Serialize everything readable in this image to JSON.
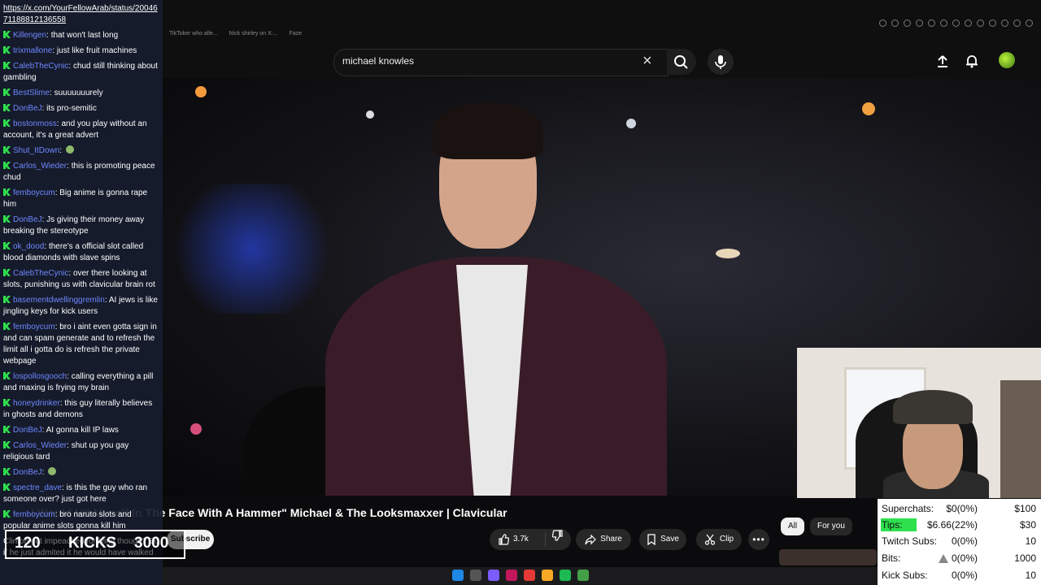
{
  "browser": {
    "tabs": [
      "TikToker who alle...",
      "Nick shirley on X:...",
      "Faze"
    ]
  },
  "youtube": {
    "search_query": "michael knowles",
    "video_title": "I Would Hit Myself In The Face With A Hammer\" Michael & The Looksmaxxer | Clavicular",
    "subscribe_label": "Subscribe",
    "like_count": "3.7k",
    "share_label": "Share",
    "save_label": "Save",
    "clip_label": "Clip",
    "more_label": "•••",
    "chips": [
      "All",
      "For you"
    ]
  },
  "chat": {
    "url": "https://x.com/YourFellowArab/status/2004671188812136558",
    "messages": [
      {
        "user": "Killengen",
        "text": "that won't last long"
      },
      {
        "user": "trixmallone",
        "text": "just like fruit machines"
      },
      {
        "user": "CalebTheCynic",
        "text": "chud still thinking about gambling"
      },
      {
        "user": "BestSlime",
        "text": "suuuuuuurely"
      },
      {
        "user": "DonBeJ",
        "text": "its pro-semitic"
      },
      {
        "user": "bostonmoss",
        "text": "and you play without an account, it's a great advert"
      },
      {
        "user": "Shut_ItDown",
        "text": ""
      },
      {
        "user": "Carlos_Wieder",
        "text": "this is promoting peace chud"
      },
      {
        "user": "femboycum",
        "text": "Big anime is gonna rape him"
      },
      {
        "user": "DonBeJ",
        "text": "Js giving their money away breaking the stereotype"
      },
      {
        "user": "ok_dood",
        "text": "there's a official slot called blood diamonds with slave spins"
      },
      {
        "user": "CalebTheCynic",
        "text": "over there looking at slots, punishing us with clavicular brain rot"
      },
      {
        "user": "basementdwellinggremlin",
        "text": "AI jews is like jingling keys for kick users"
      },
      {
        "user": "femboycum",
        "text": "bro i aint even gotta sign in and can spam generate and to refresh the limit all i gotta do is refresh the private webpage"
      },
      {
        "user": "lospollosgooch",
        "text": "calling everything a pill and maxing is frying my brain"
      },
      {
        "user": "honeydrinker",
        "text": "this guy literally believes in ghosts and demons"
      },
      {
        "user": "DonBeJ",
        "text": "AI gonna kill IP laws"
      },
      {
        "user": "Carlos_Wieder",
        "text": "shut up you gay religious tard"
      },
      {
        "user": "DonBeJ",
        "text": ""
      },
      {
        "user": "spectre_dave",
        "text": "is this the guy who ran someone over? just got here"
      },
      {
        "user": "femboycum",
        "text": "bro naruto slots and popular anime slots gonna kill him"
      },
      {
        "user": "",
        "text": "Clinton got impeached for lying though? So if he just admited it he would have walked"
      }
    ]
  },
  "kicks": {
    "left_number": "120",
    "label": "KICKS",
    "right_number": "3000"
  },
  "stats": {
    "rows": [
      {
        "label": "Superchats:",
        "value": "$0(0%)",
        "goal": "$100"
      },
      {
        "label": "Tips:",
        "value": "$6.66(22%)",
        "goal": "$30"
      },
      {
        "label": "Twitch Subs:",
        "value": "0(0%)",
        "goal": "10"
      },
      {
        "label": "Bits:",
        "value": "0(0%)",
        "goal": "1000"
      },
      {
        "label": "Kick Subs:",
        "value": "0(0%)",
        "goal": "10"
      }
    ],
    "tips_progress": 0.22,
    "colors": {
      "kick_green": "#2ee04d",
      "chat_username": "#6f87ff"
    }
  }
}
